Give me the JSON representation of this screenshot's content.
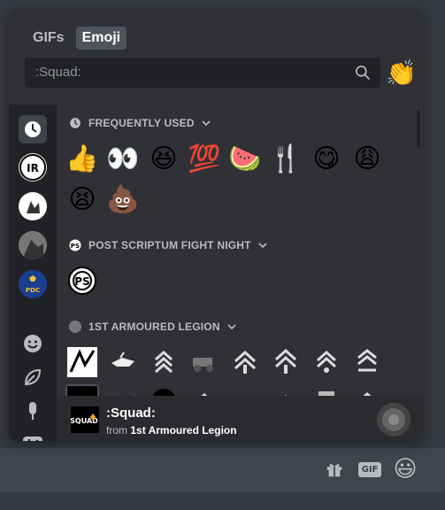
{
  "tabs": [
    {
      "label": "GIFs",
      "active": false
    },
    {
      "label": "Emoji",
      "active": true
    }
  ],
  "search": {
    "placeholder": ":Squad:",
    "icon": "search-icon"
  },
  "header_emoji": "👏",
  "sidebar": {
    "items": [
      {
        "name": "recent-icon",
        "type": "icon"
      },
      {
        "name": "guild-icon",
        "type": "server"
      },
      {
        "name": "guild-icon",
        "type": "server"
      },
      {
        "name": "guild-icon",
        "type": "server"
      },
      {
        "name": "guild-icon",
        "label": "PDC",
        "type": "server"
      },
      {
        "name": "smile-icon",
        "type": "icon"
      },
      {
        "name": "leaf-icon",
        "type": "icon"
      },
      {
        "name": "food-icon",
        "type": "icon"
      },
      {
        "name": "gamepad-icon",
        "type": "icon"
      }
    ]
  },
  "sections": [
    {
      "title": "FREQUENTLY USED",
      "emojis": [
        [
          "👍",
          "👀",
          "😆",
          "💯",
          "🍉",
          "🍴",
          "😋",
          "😩"
        ],
        [
          "😫",
          "💩"
        ]
      ]
    },
    {
      "title": "POST SCRIPTUM FIGHT NIGHT",
      "emojis": [
        [
          "guild-emoji"
        ]
      ]
    },
    {
      "title": "1ST ARMOURED LEGION",
      "emojis": [
        [
          "custom-emoji",
          "custom-emoji",
          "chevron-emoji",
          "custom-emoji",
          "custom-emoji",
          "custom-emoji",
          "chevron-emoji",
          "chevron-emoji"
        ]
      ]
    }
  ],
  "preview": {
    "title": ":Squad:",
    "from_prefix": "from",
    "from_guild": "1st Armoured Legion",
    "thumb_text": "SQUAD"
  },
  "chatbar": {
    "gift_icon": "gift-icon",
    "gif_label": "GIF",
    "emoji_icon": "😃"
  },
  "colors": {
    "background": "#36393f",
    "panel": "#2f3136",
    "sidebar": "#202225",
    "accent": "#faa61a",
    "text_muted": "#b9bbbe"
  }
}
